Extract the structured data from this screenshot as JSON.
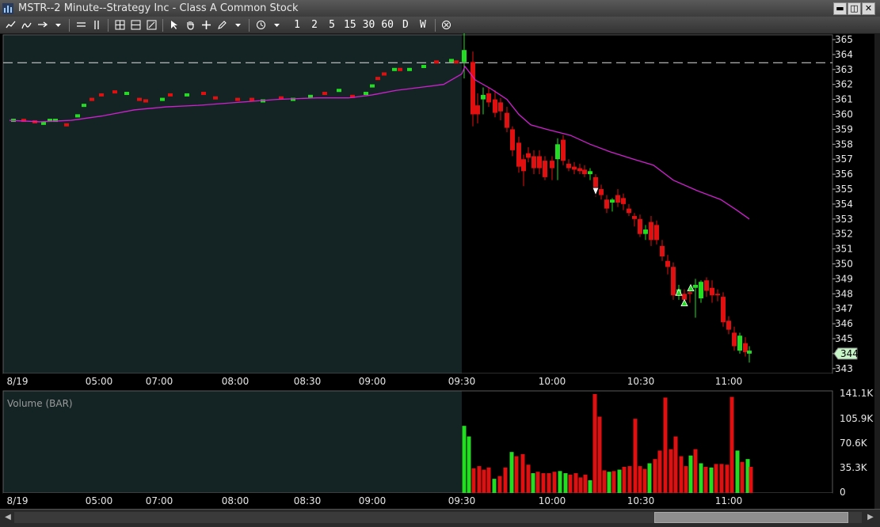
{
  "window": {
    "title": "MSTR--2 Minute--Strategy Inc - Class A Common Stock",
    "minimize": "▬",
    "restore": "◫",
    "close": "✕"
  },
  "toolbar": {
    "periods": [
      "1",
      "2",
      "5",
      "15",
      "30",
      "60",
      "D",
      "W"
    ]
  },
  "price_chart": {
    "y_ticks": [
      365,
      364,
      363,
      362,
      361,
      360,
      359,
      358,
      357,
      356,
      355,
      354,
      353,
      352,
      351,
      350,
      349,
      348,
      347,
      346,
      345,
      344,
      343
    ],
    "current_price_label": "344",
    "reference_line": 363.45,
    "session_open_time": "09:30",
    "x_labels": [
      "8/19",
      "05:00",
      "07:00",
      "08:00",
      "08:30",
      "09:00",
      "09:30",
      "10:00",
      "10:30",
      "11:00"
    ],
    "colors": {
      "up": "#22dd22",
      "down": "#e01010",
      "vwap": "#d020d0",
      "premarket_bg": "#142424",
      "session_bg": "#000000"
    }
  },
  "volume_chart": {
    "title": "Volume (BAR)",
    "y_labels": [
      "141.1K",
      "105.9K",
      "70.6K",
      "35.3K",
      "0"
    ],
    "ymax": 141100,
    "x_labels": [
      "8/19",
      "05:00",
      "07:00",
      "08:00",
      "08:30",
      "09:00",
      "09:30",
      "10:00",
      "10:30",
      "11:00"
    ]
  },
  "scrollbar": {
    "left": "◀",
    "right": "▶"
  }
}
